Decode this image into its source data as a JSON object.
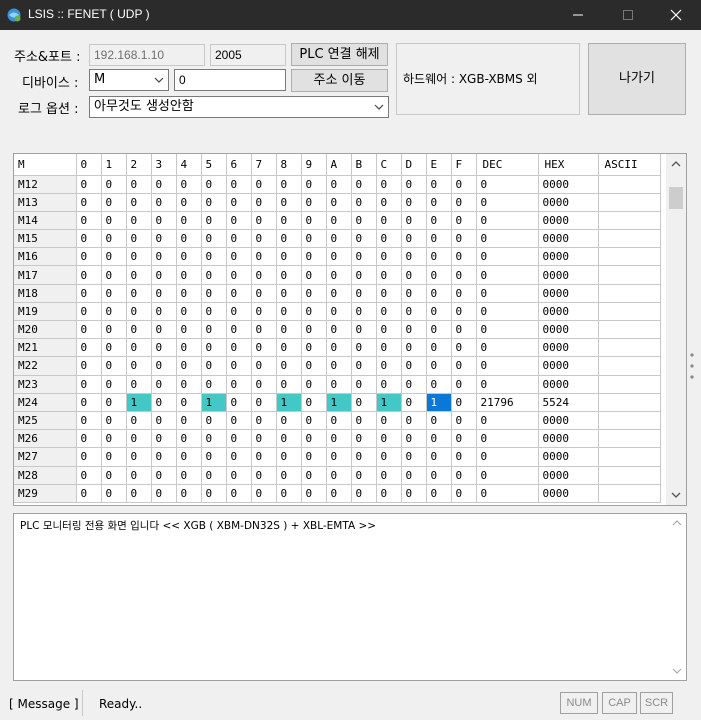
{
  "window": {
    "title": "LSIS :: FENET ( UDP )"
  },
  "controls": {
    "address_label": "주소&포트 :",
    "ip": "192.168.1.10",
    "port": "2005",
    "connect_button": "PLC 연결 해제",
    "device_label": "디바이스 :",
    "device_value": "M",
    "address_value": "0",
    "move_button": "주소 이동",
    "log_option_label": "로그 옵션 :",
    "log_option_value": "아무것도 생성안함",
    "hardware_text": "하드웨어 : XGB-XBMS 외",
    "exit_button": "나가기"
  },
  "grid": {
    "headers": [
      "M",
      "0",
      "1",
      "2",
      "3",
      "4",
      "5",
      "6",
      "7",
      "8",
      "9",
      "A",
      "B",
      "C",
      "D",
      "E",
      "F",
      "DEC",
      "HEX",
      "ASCII"
    ],
    "rows": [
      {
        "addr": "M12",
        "bits": [
          "0",
          "0",
          "0",
          "0",
          "0",
          "0",
          "0",
          "0",
          "0",
          "0",
          "0",
          "0",
          "0",
          "0",
          "0",
          "0"
        ],
        "dec": "0",
        "hex": "0000",
        "ascii": ""
      },
      {
        "addr": "M13",
        "bits": [
          "0",
          "0",
          "0",
          "0",
          "0",
          "0",
          "0",
          "0",
          "0",
          "0",
          "0",
          "0",
          "0",
          "0",
          "0",
          "0"
        ],
        "dec": "0",
        "hex": "0000",
        "ascii": ""
      },
      {
        "addr": "M14",
        "bits": [
          "0",
          "0",
          "0",
          "0",
          "0",
          "0",
          "0",
          "0",
          "0",
          "0",
          "0",
          "0",
          "0",
          "0",
          "0",
          "0"
        ],
        "dec": "0",
        "hex": "0000",
        "ascii": ""
      },
      {
        "addr": "M15",
        "bits": [
          "0",
          "0",
          "0",
          "0",
          "0",
          "0",
          "0",
          "0",
          "0",
          "0",
          "0",
          "0",
          "0",
          "0",
          "0",
          "0"
        ],
        "dec": "0",
        "hex": "0000",
        "ascii": ""
      },
      {
        "addr": "M16",
        "bits": [
          "0",
          "0",
          "0",
          "0",
          "0",
          "0",
          "0",
          "0",
          "0",
          "0",
          "0",
          "0",
          "0",
          "0",
          "0",
          "0"
        ],
        "dec": "0",
        "hex": "0000",
        "ascii": ""
      },
      {
        "addr": "M17",
        "bits": [
          "0",
          "0",
          "0",
          "0",
          "0",
          "0",
          "0",
          "0",
          "0",
          "0",
          "0",
          "0",
          "0",
          "0",
          "0",
          "0"
        ],
        "dec": "0",
        "hex": "0000",
        "ascii": ""
      },
      {
        "addr": "M18",
        "bits": [
          "0",
          "0",
          "0",
          "0",
          "0",
          "0",
          "0",
          "0",
          "0",
          "0",
          "0",
          "0",
          "0",
          "0",
          "0",
          "0"
        ],
        "dec": "0",
        "hex": "0000",
        "ascii": ""
      },
      {
        "addr": "M19",
        "bits": [
          "0",
          "0",
          "0",
          "0",
          "0",
          "0",
          "0",
          "0",
          "0",
          "0",
          "0",
          "0",
          "0",
          "0",
          "0",
          "0"
        ],
        "dec": "0",
        "hex": "0000",
        "ascii": ""
      },
      {
        "addr": "M20",
        "bits": [
          "0",
          "0",
          "0",
          "0",
          "0",
          "0",
          "0",
          "0",
          "0",
          "0",
          "0",
          "0",
          "0",
          "0",
          "0",
          "0"
        ],
        "dec": "0",
        "hex": "0000",
        "ascii": ""
      },
      {
        "addr": "M21",
        "bits": [
          "0",
          "0",
          "0",
          "0",
          "0",
          "0",
          "0",
          "0",
          "0",
          "0",
          "0",
          "0",
          "0",
          "0",
          "0",
          "0"
        ],
        "dec": "0",
        "hex": "0000",
        "ascii": ""
      },
      {
        "addr": "M22",
        "bits": [
          "0",
          "0",
          "0",
          "0",
          "0",
          "0",
          "0",
          "0",
          "0",
          "0",
          "0",
          "0",
          "0",
          "0",
          "0",
          "0"
        ],
        "dec": "0",
        "hex": "0000",
        "ascii": ""
      },
      {
        "addr": "M23",
        "bits": [
          "0",
          "0",
          "0",
          "0",
          "0",
          "0",
          "0",
          "0",
          "0",
          "0",
          "0",
          "0",
          "0",
          "0",
          "0",
          "0"
        ],
        "dec": "0",
        "hex": "0000",
        "ascii": ""
      },
      {
        "addr": "M24",
        "bits": [
          "0",
          "0",
          "1",
          "0",
          "0",
          "1",
          "0",
          "0",
          "1",
          "0",
          "1",
          "0",
          "1",
          "0",
          "1",
          "0"
        ],
        "dec": "21796",
        "hex": "5524",
        "ascii": "",
        "on_color": "#44c7c7",
        "selected_bit": 14
      },
      {
        "addr": "M25",
        "bits": [
          "0",
          "0",
          "0",
          "0",
          "0",
          "0",
          "0",
          "0",
          "0",
          "0",
          "0",
          "0",
          "0",
          "0",
          "0",
          "0"
        ],
        "dec": "0",
        "hex": "0000",
        "ascii": ""
      },
      {
        "addr": "M26",
        "bits": [
          "0",
          "0",
          "0",
          "0",
          "0",
          "0",
          "0",
          "0",
          "0",
          "0",
          "0",
          "0",
          "0",
          "0",
          "0",
          "0"
        ],
        "dec": "0",
        "hex": "0000",
        "ascii": ""
      },
      {
        "addr": "M27",
        "bits": [
          "0",
          "0",
          "0",
          "0",
          "0",
          "0",
          "0",
          "0",
          "0",
          "0",
          "0",
          "0",
          "0",
          "0",
          "0",
          "0"
        ],
        "dec": "0",
        "hex": "0000",
        "ascii": ""
      },
      {
        "addr": "M28",
        "bits": [
          "0",
          "0",
          "0",
          "0",
          "0",
          "0",
          "0",
          "0",
          "0",
          "0",
          "0",
          "0",
          "0",
          "0",
          "0",
          "0"
        ],
        "dec": "0",
        "hex": "0000",
        "ascii": ""
      },
      {
        "addr": "M29",
        "bits": [
          "0",
          "0",
          "0",
          "0",
          "0",
          "0",
          "0",
          "0",
          "0",
          "0",
          "0",
          "0",
          "0",
          "0",
          "0",
          "0"
        ],
        "dec": "0",
        "hex": "0000",
        "ascii": ""
      }
    ]
  },
  "log": {
    "text": "PLC 모니터링 전용 화면 입니다  << XGB ( XBM-DN32S ) + XBL-EMTA >>"
  },
  "status": {
    "message_label": "[ Message ]",
    "ready": "Ready..",
    "num": "NUM",
    "cap": "CAP",
    "scr": "SCR"
  }
}
